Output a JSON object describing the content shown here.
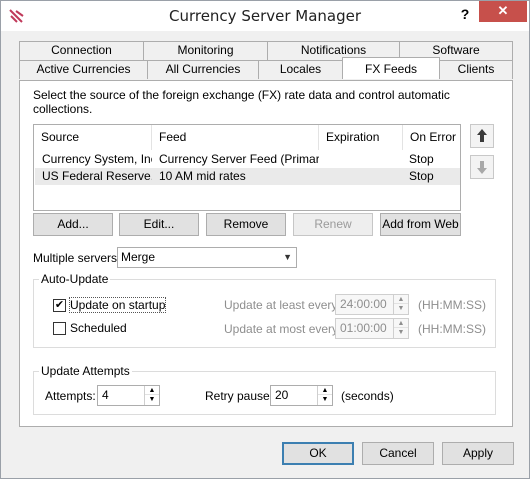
{
  "window": {
    "title": "Currency Server Manager",
    "help_label": "?",
    "close_label": "✕"
  },
  "tabs": {
    "back_row": [
      "Connection",
      "Monitoring",
      "Notifications",
      "Software"
    ],
    "front_row": [
      "Active Currencies",
      "All Currencies",
      "Locales",
      "FX Feeds",
      "Clients"
    ],
    "active": "FX Feeds"
  },
  "fx_feeds": {
    "intro": "Select the source of the foreign exchange (FX) rate data and control automatic collections.",
    "columns": [
      "Source",
      "Feed",
      "Expiration",
      "On Error"
    ],
    "rows": [
      {
        "source": "Currency System, Inc.",
        "feed": "Currency Server Feed (Primary)",
        "expiration": "",
        "on_error": "Stop"
      },
      {
        "source": "US Federal Reserve...",
        "feed": "10 AM mid rates",
        "expiration": "",
        "on_error": "Stop"
      }
    ],
    "buttons": {
      "add": "Add...",
      "edit": "Edit...",
      "remove": "Remove",
      "renew": "Renew",
      "add_from_web": "Add from Web"
    },
    "multiple_servers": {
      "label": "Multiple servers:",
      "value": "Merge"
    },
    "auto_update": {
      "title": "Auto-Update",
      "update_on_startup": {
        "label": "Update on startup",
        "checked": true
      },
      "scheduled": {
        "label": "Scheduled",
        "checked": false
      },
      "least_label": "Update at least every:",
      "least_value": "24:00:00",
      "most_label": "Update at most every:",
      "most_value": "01:00:00",
      "format": "(HH:MM:SS)"
    },
    "update_attempts": {
      "title": "Update Attempts",
      "attempts_label": "Attempts:",
      "attempts_value": "4",
      "retry_label": "Retry pause:",
      "retry_value": "20",
      "retry_unit": "(seconds)"
    }
  },
  "footer": {
    "ok": "OK",
    "cancel": "Cancel",
    "apply": "Apply"
  },
  "colors": {
    "close": "#c7504b",
    "selected_row": "#eaeaea",
    "default_border": "#3c7fb1",
    "app_icon": "#c0395a"
  }
}
